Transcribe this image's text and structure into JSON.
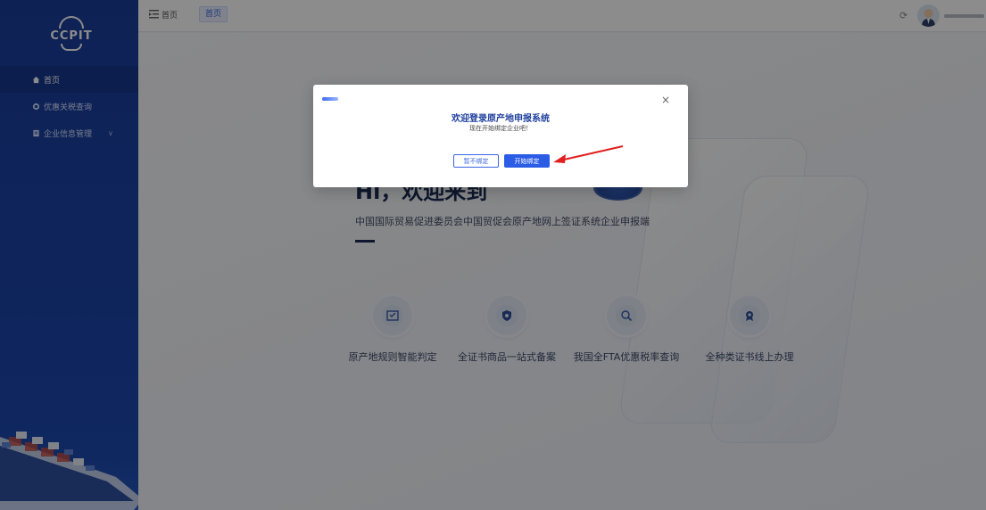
{
  "sidebar": {
    "logo_text": "CCPIT",
    "items": [
      {
        "label": "首页",
        "icon": "home-icon",
        "active": true
      },
      {
        "label": "优惠关税查询",
        "icon": "search-icon",
        "active": false
      },
      {
        "label": "企业信息管理",
        "icon": "document-icon",
        "active": false,
        "has_children": true
      }
    ]
  },
  "topbar": {
    "breadcrumb": "首页",
    "tab": "首页",
    "refresh_icon": "refresh-icon"
  },
  "hero": {
    "title": "Hi，欢迎来到",
    "subtitle": "中国国际贸易促进委员会中国贸促会原产地网上签证系统企业申报端"
  },
  "features": [
    {
      "label": "原产地规则智能判定",
      "icon": "rules-icon"
    },
    {
      "label": "全证书商品一站式备案",
      "icon": "shield-star-icon"
    },
    {
      "label": "我国全FTA优惠税率查询",
      "icon": "magnifier-icon"
    },
    {
      "label": "全种类证书线上办理",
      "icon": "certificate-icon"
    }
  ],
  "modal": {
    "title": "欢迎登录原产地申报系统",
    "subtitle": "现在开始绑定企业吧！",
    "skip_label": "暂不绑定",
    "bind_label": "开始绑定",
    "close_symbol": "×"
  },
  "colors": {
    "sidebar": "#1b44a8",
    "accent": "#2b5ce6",
    "arrow": "#e02020"
  }
}
